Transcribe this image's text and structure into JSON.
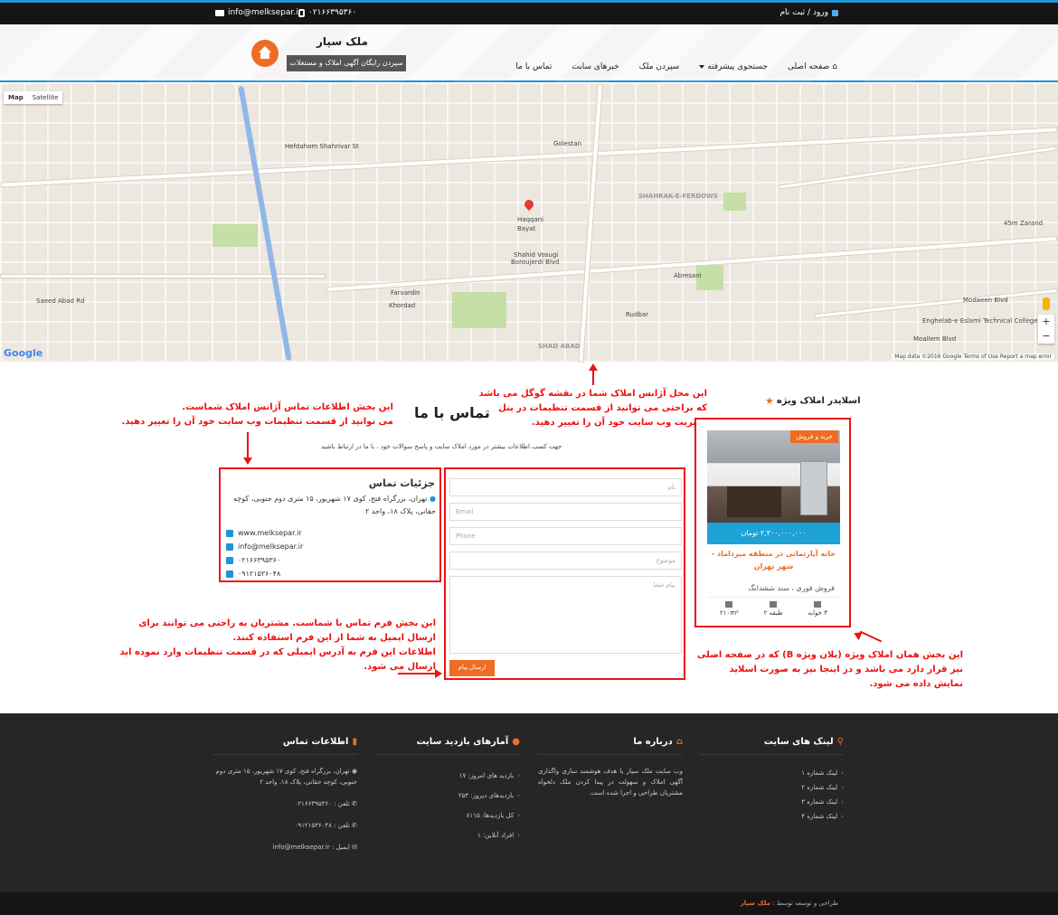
{
  "topbar": {
    "email": "info@melksepar.ir",
    "phone": "۰۲۱۶۶۳۹۵۳۶۰",
    "login": "ورود / ثبت نام"
  },
  "header": {
    "brand_name": "ملک سپار",
    "brand_tagline": "سپردن رایگان آگهی املاک و مستغلات",
    "nav": [
      {
        "label": "صفحه اصلی"
      },
      {
        "label": "جستجوی پیشرفته"
      },
      {
        "label": "سپردن ملک"
      },
      {
        "label": "خبرهای سایت"
      },
      {
        "label": "تماس با ما"
      }
    ]
  },
  "map": {
    "mode_map": "Map",
    "mode_satellite": "Satellite",
    "google": "Google",
    "footer": "Map data ©2016 Google   Terms of Use   Report a map error",
    "labels": [
      "Hefdahom Shahrivar St",
      "Boroujerdi Blvd",
      "Saeed Abad Rd",
      "Modaeen Blvd",
      "45m Zarand",
      "SHAHRAK-E-FERDOWS",
      "Enghelab-e Eslami Technical College",
      "Haqqani",
      "Shahid Vosugi",
      "Abresani",
      "Farvardin",
      "Khordad",
      "Golestan",
      "Rudbar",
      "SHAD ABAD",
      "Moallem Blvd",
      "Bayat"
    ],
    "zoom_in": "+",
    "zoom_out": "−"
  },
  "annotations": {
    "map_note": [
      "این محل آژانس املاک شما در نقشه گوگل می باشد",
      "که براحتی می توانید از قسمت تنظیمات در پنل",
      "مدیریت وب سایت خود آن را تغییر دهید."
    ],
    "contact_note": [
      "این بخش اطلاعات تماس آژانس املاک شماست.",
      "می توانید از قسمت تنظیمات وب سایت خود آن را تغییر دهید."
    ],
    "form_note": [
      "این بخش فرم تماس با شماست. مشتریان به راحتی می توانند برای",
      "ارسال ایمیل به شما از این فرم استفاده کنند.",
      "اطلاعات این فرم به آدرس ایمیلی که در قسمت تنظیمات وارد نموده اید",
      "ارسال می شود."
    ],
    "slider_note": [
      "این بخش همان املاک ویژه (پلان ویژه B) که در صفحه اصلی",
      "نیز قرار دارد می باشد و در اینجا نیز به صورت اسلاید",
      "نمایش داده می شود."
    ]
  },
  "contact": {
    "title": "تماس با ما",
    "subtitle": "جهت کسب اطلاعات بیشتر در مورد املاک سایت و پاسخ سوالات خود ، با ما در ارتباط باشید",
    "details_title": "جزئیات تماس",
    "address": "تهران، بزرگراه فتح، کوی ۱۷ شهریور، ۱۵ متری دوم جنوبی، کوچه حقانی، پلاک ۱۸، واحد ۲",
    "website": "www.melksepar.ir",
    "email": "info@melksepar.ir",
    "phone1": "۰۲۱۶۶۳۹۵۳۶۰",
    "phone2": "۰۹۱۲۱۵۳۶۰۴۸"
  },
  "form": {
    "name_placeholder": "نام",
    "email_placeholder": "Email",
    "phone_placeholder": "Phone",
    "subject_placeholder": "موضوع",
    "message_placeholder": "پیام شما",
    "submit": "ارسال پیام"
  },
  "slider": {
    "title": "اسلایدر املاک ویژه",
    "badge": "خرید و فروش",
    "price": "۲,۳۰۰,۰۰۰,۰۰۰ تومان",
    "listing_title": "خانه آپارتمانی در منطقه میرداماد - شهر تهران",
    "listing_desc": "فروش فوری ، سند ششدانگ",
    "area": "۲۱۰m²",
    "floor": "طبقه ۲",
    "bedrooms": "۳ خوابه"
  },
  "footer": {
    "links_title": "لینک های سایت",
    "links": [
      "لینک شماره ۱",
      "لینک شماره ۲",
      "لینک شماره ۳",
      "لینک شماره ۴"
    ],
    "about_title": "درباره ما",
    "about_text": "وب سایت ملک سپار با هدف هوشمند سازی واگذاری آگهی املاک و سهولت در پیدا کردن ملک دلخواه مشتریان طراحی و اجرا شده است.",
    "stats_title": "آمارهای بازدید سایت",
    "stats": [
      "بازدید های امروز: ۱۷",
      "بازدیدهای دیروز: ۲۵۴",
      "کل بازدیدها: ۸۱۱۵",
      "افراد آنلاین: ۱"
    ],
    "contact_title": "اطلاعات تماس",
    "contact_address": "تهران، بزرگراه فتح، کوی ۱۷ شهریور، ۱۵ متری دوم جنوبی، کوچه حقانی، پلاک ۱۸، واحد ۲",
    "contact_phone1": "تلفن : ۰۲۱۶۶۳۹۵۳۶۰",
    "contact_phone2": "تلفن : ۰۹۱۲۱۵۳۶۰۴۸",
    "contact_email": "ایمیل : info@melksepar.ir",
    "copyright_prefix": "طراحی و توسعه توسط :",
    "copyright_brand": "ملک سپار"
  },
  "colors": {
    "accent": "#ef6c24",
    "blue": "#1f95d4",
    "annotation": "#ee1111",
    "footer_bg": "#262626"
  }
}
